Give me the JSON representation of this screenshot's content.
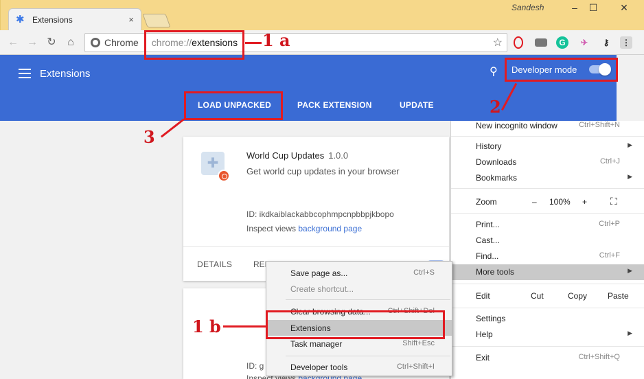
{
  "window": {
    "tab_title": "Extensions",
    "tab_close": "×",
    "user": "Sandesh",
    "minimize": "–",
    "maximize": "☐",
    "close": "✕"
  },
  "toolbar": {
    "back": "←",
    "forward": "→",
    "reload": "↻",
    "home": "⌂",
    "site_chip": "Chrome",
    "url_scheme": "chrome://",
    "url_host": "extensions",
    "star": "☆"
  },
  "extension_icons": [
    "opera-icon",
    "mail-icon",
    "grammarly-icon",
    "bird-icon",
    "key-icon",
    "more-menu-icon"
  ],
  "page": {
    "title": "Extensions",
    "developer_mode_label": "Developer mode",
    "developer_mode_on": true,
    "actions": [
      "LOAD UNPACKED",
      "PACK EXTENSION",
      "UPDATE"
    ]
  },
  "card": {
    "name": "World Cup Updates",
    "version": "1.0.0",
    "description": "Get world cup updates in your browser",
    "id_line": "ID: ikdkaiblackabbcophmpcnpbbpjkbopo",
    "inspect_label": "Inspect views",
    "inspect_link": "background page",
    "details": "DETAILS",
    "remove": "REMOVE"
  },
  "card2": {
    "id_line": "ID: g",
    "inspect_label": "Inspect views",
    "inspect_link": "background page"
  },
  "chrome_menu": {
    "partial_item": "New incognito window",
    "partial_shortcut": "Ctrl+Shift+N",
    "history": "History",
    "downloads": "Downloads",
    "downloads_shortcut": "Ctrl+J",
    "bookmarks": "Bookmarks",
    "zoom": "Zoom",
    "zoom_minus": "–",
    "zoom_value": "100%",
    "zoom_plus": "+",
    "print": "Print...",
    "print_shortcut": "Ctrl+P",
    "cast": "Cast...",
    "find": "Find...",
    "find_shortcut": "Ctrl+F",
    "more_tools": "More tools",
    "edit": "Edit",
    "cut": "Cut",
    "copy": "Copy",
    "paste": "Paste",
    "settings": "Settings",
    "help": "Help",
    "exit": "Exit",
    "exit_shortcut": "Ctrl+Shift+Q"
  },
  "more_tools_menu": [
    {
      "label": "Save page as...",
      "shortcut": "Ctrl+S"
    },
    {
      "label": "Create shortcut...",
      "shortcut": ""
    },
    {
      "label": "Clear browsing data...",
      "shortcut": "Ctrl+Shift+Del"
    },
    {
      "label": "Extensions",
      "shortcut": ""
    },
    {
      "label": "Task manager",
      "shortcut": "Shift+Esc"
    },
    {
      "label": "Developer tools",
      "shortcut": "Ctrl+Shift+I"
    }
  ],
  "annotations": {
    "a1": "1 a",
    "a1b": "1 b",
    "a2": "2",
    "a3": "3",
    "color": "#e11b22"
  }
}
